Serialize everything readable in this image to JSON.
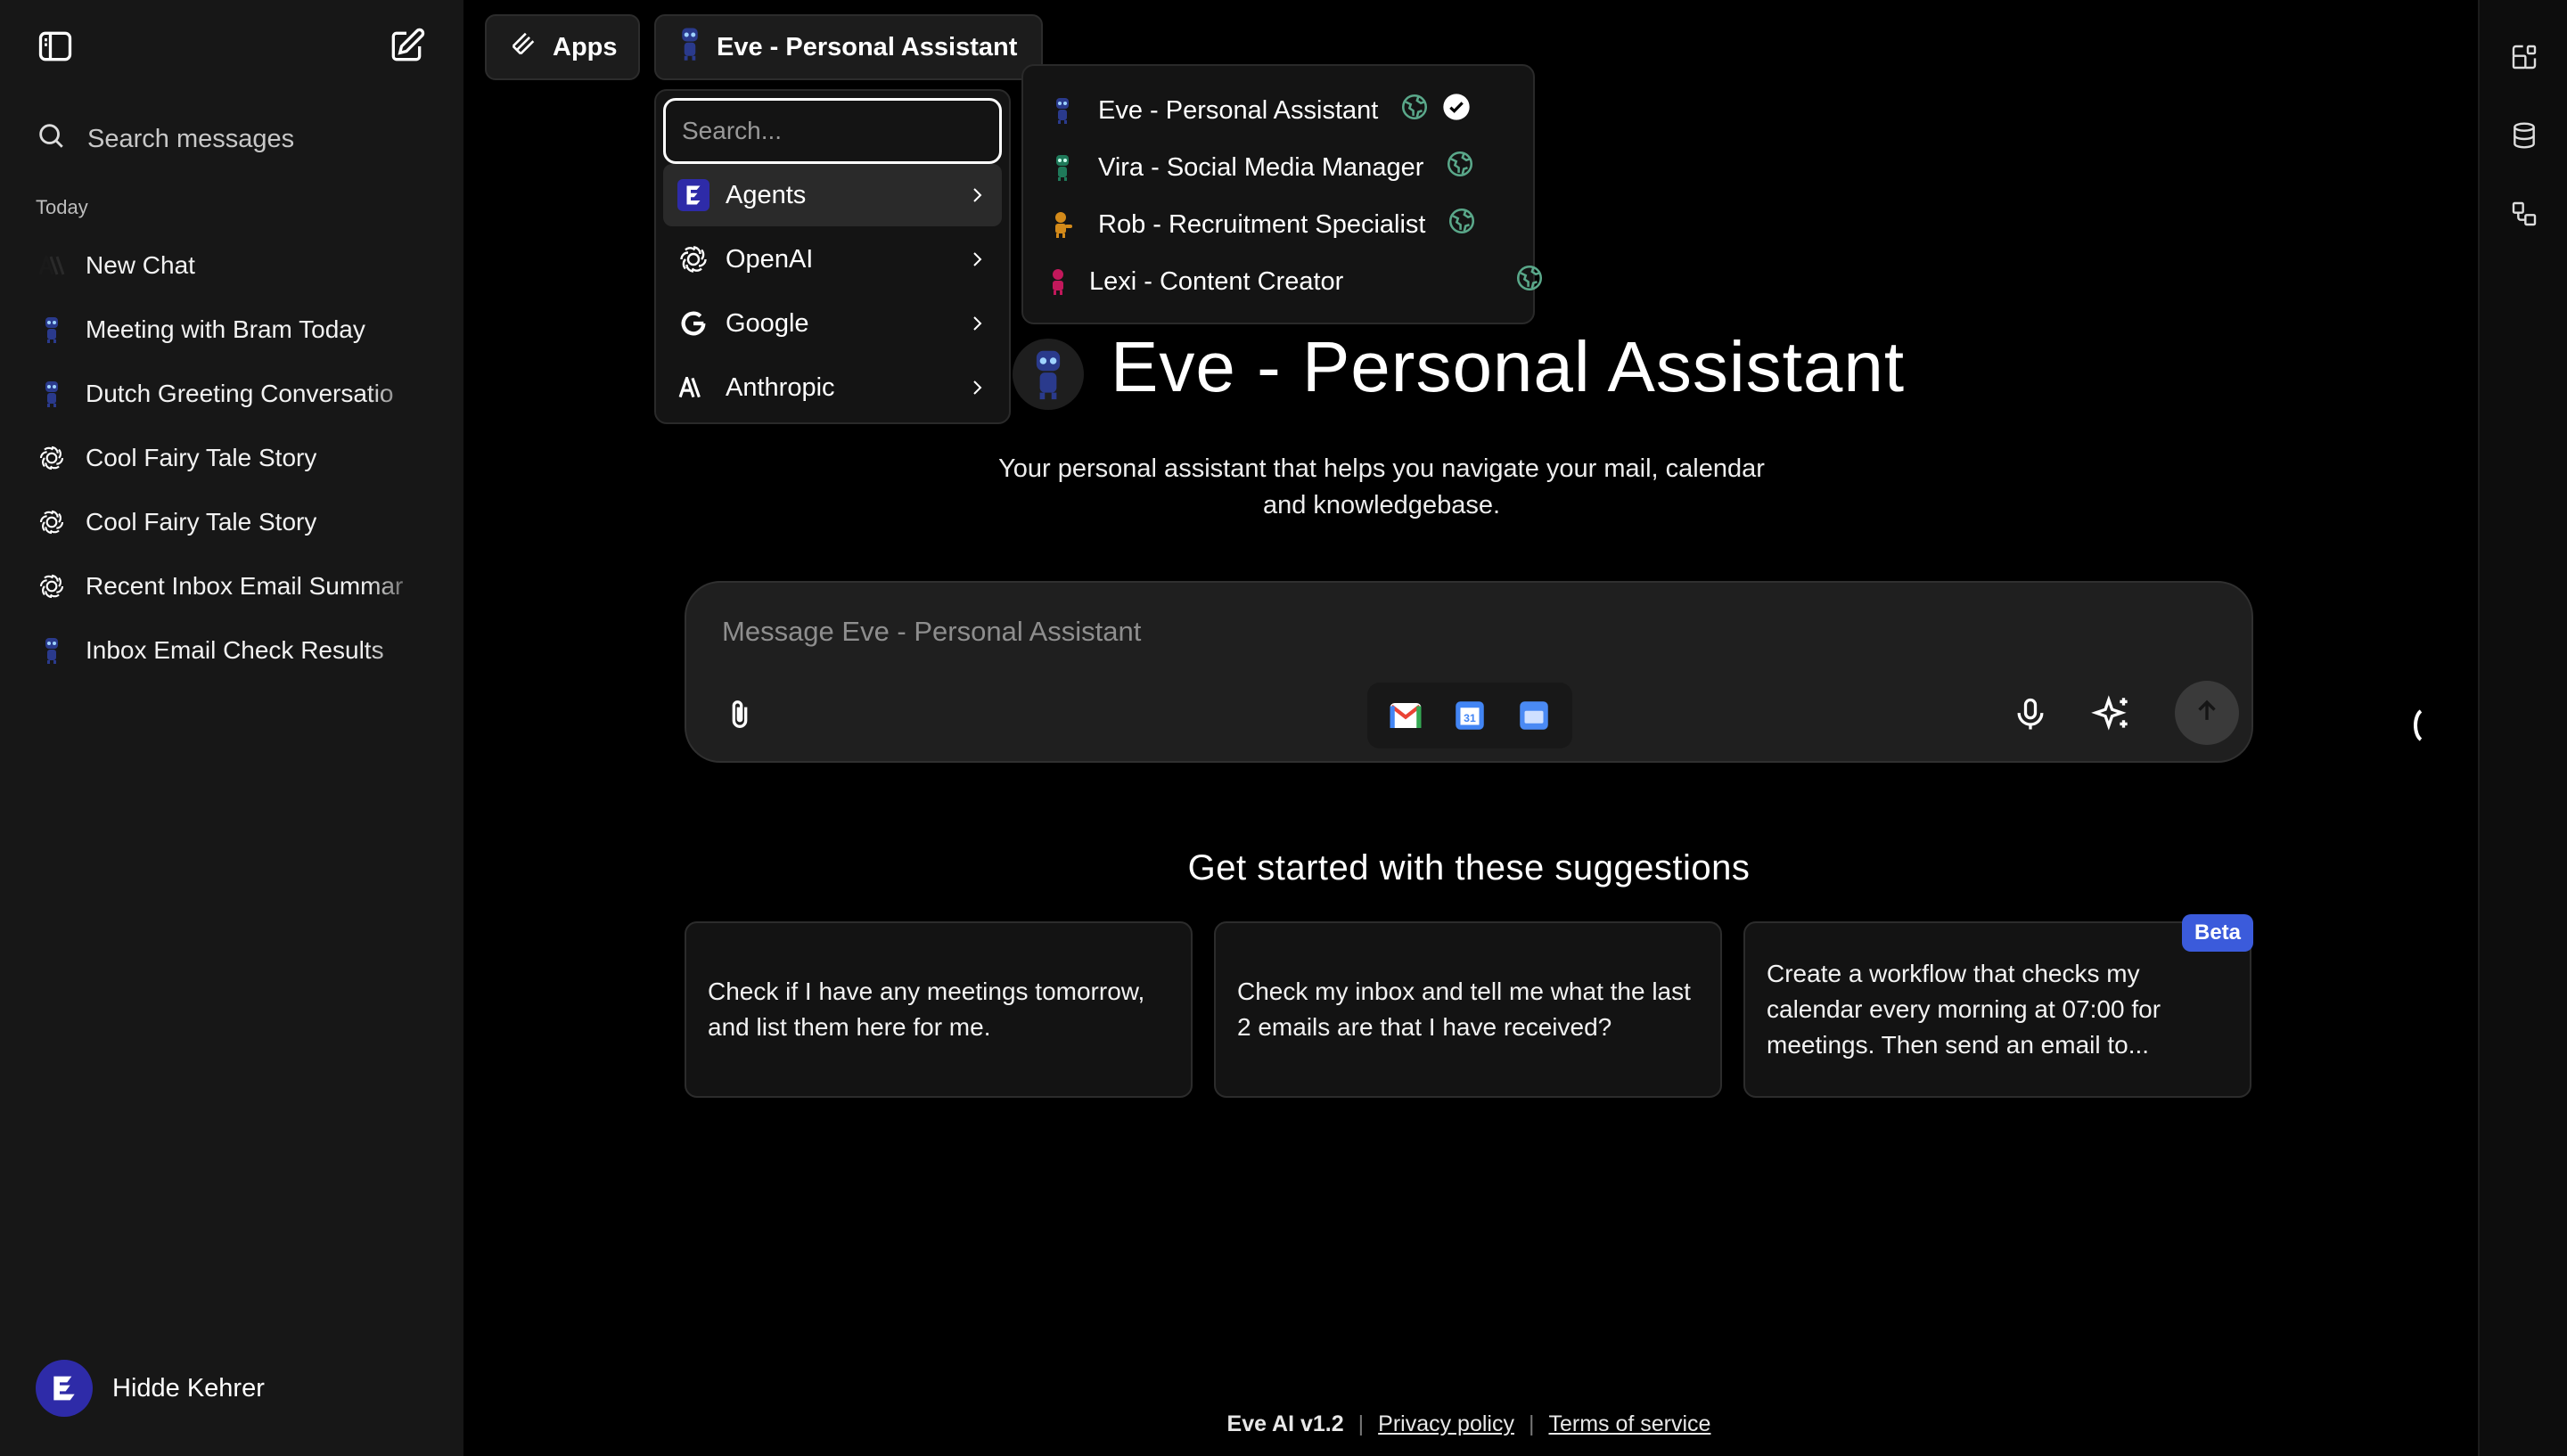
{
  "sidebar": {
    "search_placeholder": "Search messages",
    "section": "Today",
    "items": [
      {
        "label": "New Chat",
        "icon": "anthropic-icon"
      },
      {
        "label": "Meeting with Bram Today",
        "icon": "robot-agent-icon"
      },
      {
        "label": "Dutch Greeting Conversatio",
        "icon": "robot-agent-icon"
      },
      {
        "label": "Cool Fairy Tale Story",
        "icon": "openai-icon"
      },
      {
        "label": "Cool Fairy Tale Story",
        "icon": "openai-icon"
      },
      {
        "label": "Recent Inbox Email Summar",
        "icon": "openai-icon"
      },
      {
        "label": "Inbox Email Check Results",
        "icon": "robot-agent-icon"
      }
    ],
    "user": {
      "name": "Hidde Kehrer"
    }
  },
  "topbar": {
    "apps_label": "Apps",
    "agent_label": "Eve - Personal Assistant"
  },
  "menu": {
    "search_placeholder": "Search...",
    "providers": [
      {
        "label": "Agents",
        "icon": "eve-logo-icon"
      },
      {
        "label": "OpenAI",
        "icon": "openai-icon"
      },
      {
        "label": "Google",
        "icon": "google-icon"
      },
      {
        "label": "Anthropic",
        "icon": "anthropic-icon"
      }
    ]
  },
  "submenu": {
    "agents": [
      {
        "label": "Eve - Personal Assistant",
        "color": "#2a3a8c",
        "selected": true
      },
      {
        "label": "Vira - Social Media Manager",
        "color": "#1f7a5a",
        "selected": false
      },
      {
        "label": "Rob - Recruitment Specialist",
        "color": "#d38a1a",
        "selected": false
      },
      {
        "label": "Lexi - Content Creator",
        "color": "#c2185b",
        "selected": false
      }
    ]
  },
  "hero": {
    "title": "Eve - Personal Assistant",
    "description": "Your personal assistant that helps you navigate your mail, calendar and knowledgebase."
  },
  "composer": {
    "placeholder": "Message Eve - Personal Assistant",
    "apps": [
      "gmail-icon",
      "google-calendar-icon",
      "google-drive-icon"
    ]
  },
  "suggestions": {
    "title": "Get started with these suggestions",
    "cards": [
      {
        "text": "Check if I have any meetings tomorrow, and list them here for me."
      },
      {
        "text": "Check my inbox and tell me what the last 2 emails are that I have received?"
      },
      {
        "text": "Create a workflow that checks my calendar every morning at 07:00 for meetings. Then send an email to..."
      }
    ],
    "beta_label": "Beta"
  },
  "footer": {
    "version": "Eve AI v1.2",
    "privacy": "Privacy policy",
    "terms": "Terms of service"
  },
  "colors": {
    "background": "#000000",
    "sidebar": "#171717",
    "accent": "#3b5bdb"
  }
}
